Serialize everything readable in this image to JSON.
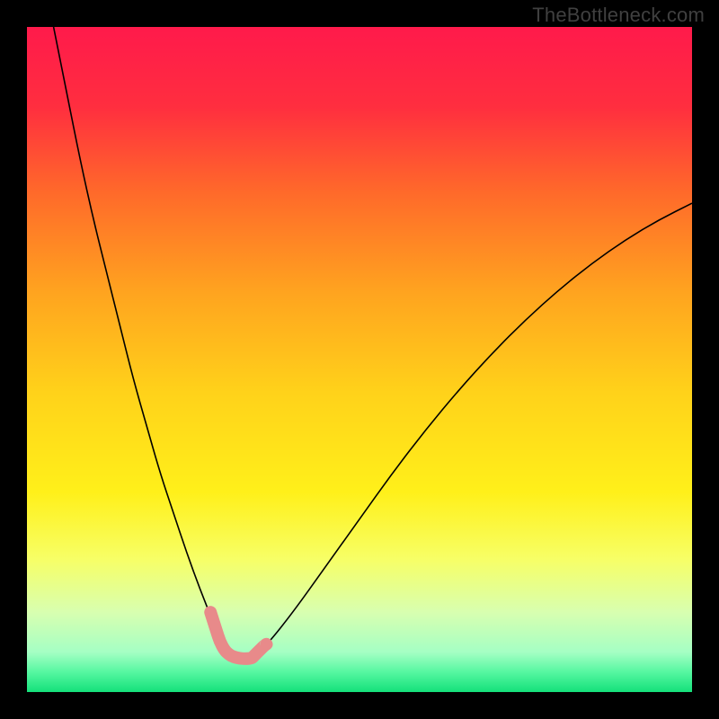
{
  "watermark": "TheBottleneck.com",
  "frame": {
    "outer_width": 800,
    "outer_height": 800,
    "border_px": 30,
    "border_color": "#000000"
  },
  "gradient": {
    "stops": [
      {
        "offset": 0.0,
        "color": "#ff1a4b"
      },
      {
        "offset": 0.12,
        "color": "#ff2e3f"
      },
      {
        "offset": 0.25,
        "color": "#ff6a2a"
      },
      {
        "offset": 0.4,
        "color": "#ffa41f"
      },
      {
        "offset": 0.55,
        "color": "#ffd21a"
      },
      {
        "offset": 0.7,
        "color": "#fff01a"
      },
      {
        "offset": 0.8,
        "color": "#f7ff66"
      },
      {
        "offset": 0.88,
        "color": "#d8ffb0"
      },
      {
        "offset": 0.94,
        "color": "#a5ffc4"
      },
      {
        "offset": 0.97,
        "color": "#56f7a1"
      },
      {
        "offset": 1.0,
        "color": "#14e07a"
      }
    ]
  },
  "chart_data": {
    "type": "line",
    "title": "",
    "xlabel": "",
    "ylabel": "",
    "xlim": [
      0,
      100
    ],
    "ylim": [
      0,
      100
    ],
    "legend": false,
    "grid": false,
    "series": [
      {
        "name": "bottleneck-curve",
        "color": "#000000",
        "width": 1.6,
        "x": [
          4,
          6,
          8,
          10,
          12,
          14,
          16,
          18,
          20,
          22,
          24,
          26,
          28,
          28.5,
          29.7,
          31,
          33,
          34,
          36,
          40,
          45,
          50,
          55,
          60,
          65,
          70,
          75,
          80,
          85,
          90,
          95,
          100
        ],
        "y": [
          100,
          90,
          80,
          71,
          63,
          55,
          47,
          40,
          33,
          27,
          21,
          15.5,
          10.5,
          9,
          6,
          5.2,
          5.0,
          5.3,
          7,
          12,
          19,
          26,
          33,
          39.5,
          45.5,
          51,
          56,
          60.5,
          64.5,
          68,
          71,
          73.5
        ]
      },
      {
        "name": "optimal-band",
        "color": "#e88a8a",
        "width": 14,
        "round_caps": true,
        "x": [
          27.6,
          28.5,
          29.0,
          29.7,
          30.3,
          31.0,
          32.0,
          33.0,
          33.8,
          34.0,
          34.3,
          35.0,
          35.6,
          36.0
        ],
        "y": [
          12.0,
          9.2,
          7.6,
          6.3,
          5.7,
          5.3,
          5.05,
          5.0,
          5.1,
          5.3,
          5.6,
          6.3,
          6.9,
          7.2
        ]
      }
    ]
  }
}
